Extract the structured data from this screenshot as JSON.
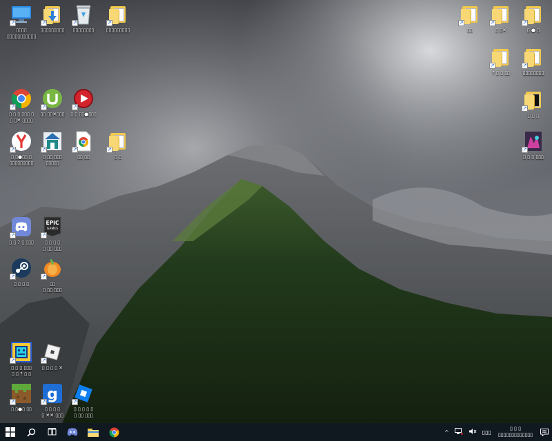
{
  "desktop": {
    "left_icons": [
      {
        "label": "▯▯▯▯\n▯▯▯▯▯▯▯▯▯▯▯",
        "icon": "this-pc-icon"
      },
      {
        "label": "▯▯▯▯▯▯▯▯▯",
        "icon": "downloads-folder-icon"
      },
      {
        "label": "▯▯▯▯▯▯▯▯",
        "icon": "recycle-bin-icon"
      },
      {
        "label": "▯▯▯▯▯▯▯▯▯",
        "icon": "documents-folder-icon"
      },
      {
        "label": "▯ ▯ ▯ ▯▯▯ ▯\n▯ ▯✕ ▯▯▯▯",
        "icon": "chrome-icon"
      },
      {
        "label": "▯▯ ▯▯✕▯▯▯",
        "icon": "utorrent-icon"
      },
      {
        "label": "▯ ▯ ▯▯●▯▯▯",
        "icon": "media-player-icon"
      },
      {
        "label": "▯ ▯●▯▯ ▯\n▯▯▯▯▯▯▯▯▯",
        "icon": "yandex-browser-icon"
      },
      {
        "label": "▯ ▯▯ ▯▯▯\n▯▯▯▯▯",
        "icon": "app-installer-icon"
      },
      {
        "label": "▯▯ ▯▯",
        "icon": "chrome-doc-icon"
      },
      {
        "label": "▯ ▯",
        "icon": "folder-icon"
      },
      {
        "label": "▯ ▯ ? ▯ ▯▯▯",
        "icon": "discord-icon"
      },
      {
        "label": "▯ ▯ ▯ ▯\n▯ ▯▯ ▯▯▯",
        "icon": "epic-games-icon"
      },
      {
        "label": "▯ ▯ ▯ ▯",
        "icon": "steam-icon"
      },
      {
        "label": "▯▯\n▯ ▯▯ ▯▯▯",
        "icon": "fl-studio-icon"
      },
      {
        "label": "▯ ▯ ▯ ▯▯▯\n▯ ▯ ? ▯ ▯",
        "icon": "geometry-dash-icon"
      },
      {
        "label": "▯ ▯ ▯ ▯ ✕",
        "icon": "roblox-icon"
      },
      {
        "label": "▯ ▯●▯ ▯▯",
        "icon": "minecraft-icon"
      },
      {
        "label": "▯ ▯ ▯ ▯\n▯ ✕✕ ▯▯▯",
        "icon": "garrys-mod-icon"
      },
      {
        "label": "▯ ▯ ▯ ▯ ▯\n▯ ▯▯ ▯▯▯",
        "icon": "roblox-studio-icon"
      }
    ],
    "right_icons": [
      {
        "label": "▯▯",
        "icon": "folder-icon"
      },
      {
        "label": "▯ ▯✕",
        "icon": "folder-icon"
      },
      {
        "label": "▯ ● ▯",
        "icon": "folder-icon"
      },
      {
        "label": "? ▯ ▯ ▯▯",
        "icon": "folder-icon"
      },
      {
        "label": "▯▯▯▯▯▯▯▯",
        "icon": "folder-icon"
      },
      {
        "label": "▯ ▯ ▯",
        "icon": "black-file-icon"
      },
      {
        "label": "▯ ▯ ▯ ▯▯▯",
        "icon": "game-shortcut-icon"
      }
    ]
  },
  "taskbar": {
    "start_icon": "windows-start-icon",
    "search_icon": "search-icon",
    "taskview_icon": "task-view-icon",
    "pinned": [
      "discord-icon",
      "file-explorer-icon",
      "chrome-icon"
    ],
    "tray_chevron": "^",
    "tray_lang": "▯▯▯",
    "clock_time": "▯ ▯ ▯",
    "clock_date": "▯▯▯▯▯▯▯▯▯▯▯▯▯",
    "notification_icon": "notification-icon"
  },
  "colors": {
    "taskbar": "#101820",
    "folder": "#f2c94c"
  }
}
